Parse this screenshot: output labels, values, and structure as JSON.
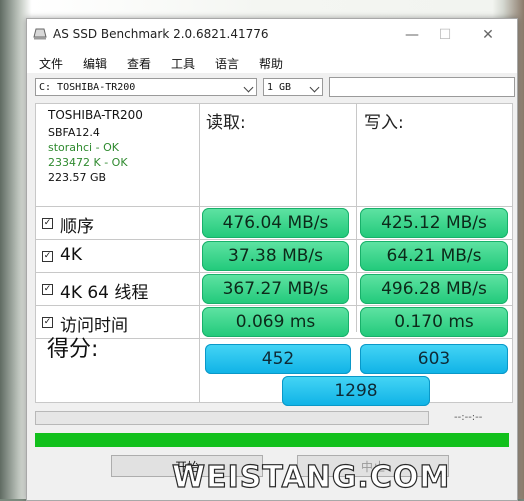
{
  "window": {
    "title": "AS SSD Benchmark 2.0.6821.41776",
    "controls": {
      "minimize": "—",
      "maximize": "☐",
      "close": "✕"
    }
  },
  "menu": [
    "文件",
    "编辑",
    "查看",
    "工具",
    "语言",
    "帮助"
  ],
  "toolbar": {
    "drive_select": "C: TOSHIBA-TR200",
    "size_select": "1 GB",
    "text_field": ""
  },
  "drive_info": {
    "model": "TOSHIBA-TR200",
    "firmware": "SBFA12.4",
    "driver": "storahci - OK",
    "alignment": "233472 K - OK",
    "capacity": "223.57 GB"
  },
  "columns": {
    "read": "读取:",
    "write": "写入:"
  },
  "rows": [
    {
      "label": "顺序",
      "read": "476.04 MB/s",
      "write": "425.12 MB/s"
    },
    {
      "label": "4K",
      "read": "37.38 MB/s",
      "write": "64.21 MB/s"
    },
    {
      "label": "4K 64 线程",
      "read": "367.27 MB/s",
      "write": "496.28 MB/s"
    },
    {
      "label": "访问时间",
      "read": "0.069 ms",
      "write": "0.170 ms"
    }
  ],
  "score": {
    "label": "得分:",
    "read": "452",
    "write": "603",
    "total": "1298"
  },
  "status": {
    "timer": "--:--:--",
    "progress": 1.0
  },
  "buttons": {
    "start": "开始",
    "abort": "中止"
  },
  "watermark": "WEISTANG.COM",
  "colors": {
    "value_green": "#21c97a",
    "score_blue": "#0fb2e6",
    "progress_green": "#12c01c"
  }
}
